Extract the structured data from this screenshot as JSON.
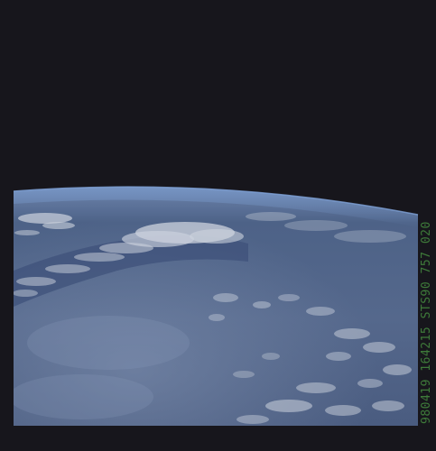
{
  "photo": {
    "frame_id": "980419 164215 STS90  757 020"
  },
  "colors": {
    "space": "#17161c",
    "ocean": "#4a5e7f",
    "ocean_deep": "#3b4f74",
    "haze": "#6c7fa3",
    "cloud": "#c9d0da",
    "limb": "#5a7fb5",
    "label": "#3e7a3a"
  }
}
